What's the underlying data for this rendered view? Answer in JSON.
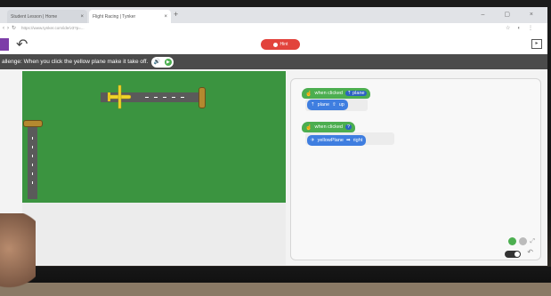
{
  "browser": {
    "tabs": [
      {
        "title": "Student Lesson | Home"
      },
      {
        "title": "Flight Racing | Tynker"
      }
    ],
    "url": "https://www.tynker.com/ide/v3?p=..."
  },
  "toolbar": {
    "run_label": "Hint"
  },
  "challenge": {
    "text": "allenge: When you click the yellow plane make it take off."
  },
  "workspace": {
    "script1": {
      "event_label": "when clicked",
      "event_target": "plane",
      "action_target": "plane",
      "action_verb": "up"
    },
    "script2": {
      "event_label": "when clicked",
      "event_target": "?",
      "action_target": "yellowPlane",
      "action_verb": "right"
    }
  },
  "colors": {
    "challenge_bar": "#4b4b4b",
    "stage_green": "#3b9440",
    "event_block": "#4cae50",
    "action_block": "#3f7ee0",
    "run_button": "#e2433c",
    "plane": "#f2d52b"
  },
  "icons": {
    "undo": "undo-icon",
    "exit": "exit-fullscreen-icon",
    "speaker": "speaker-icon",
    "play": "play-icon"
  }
}
